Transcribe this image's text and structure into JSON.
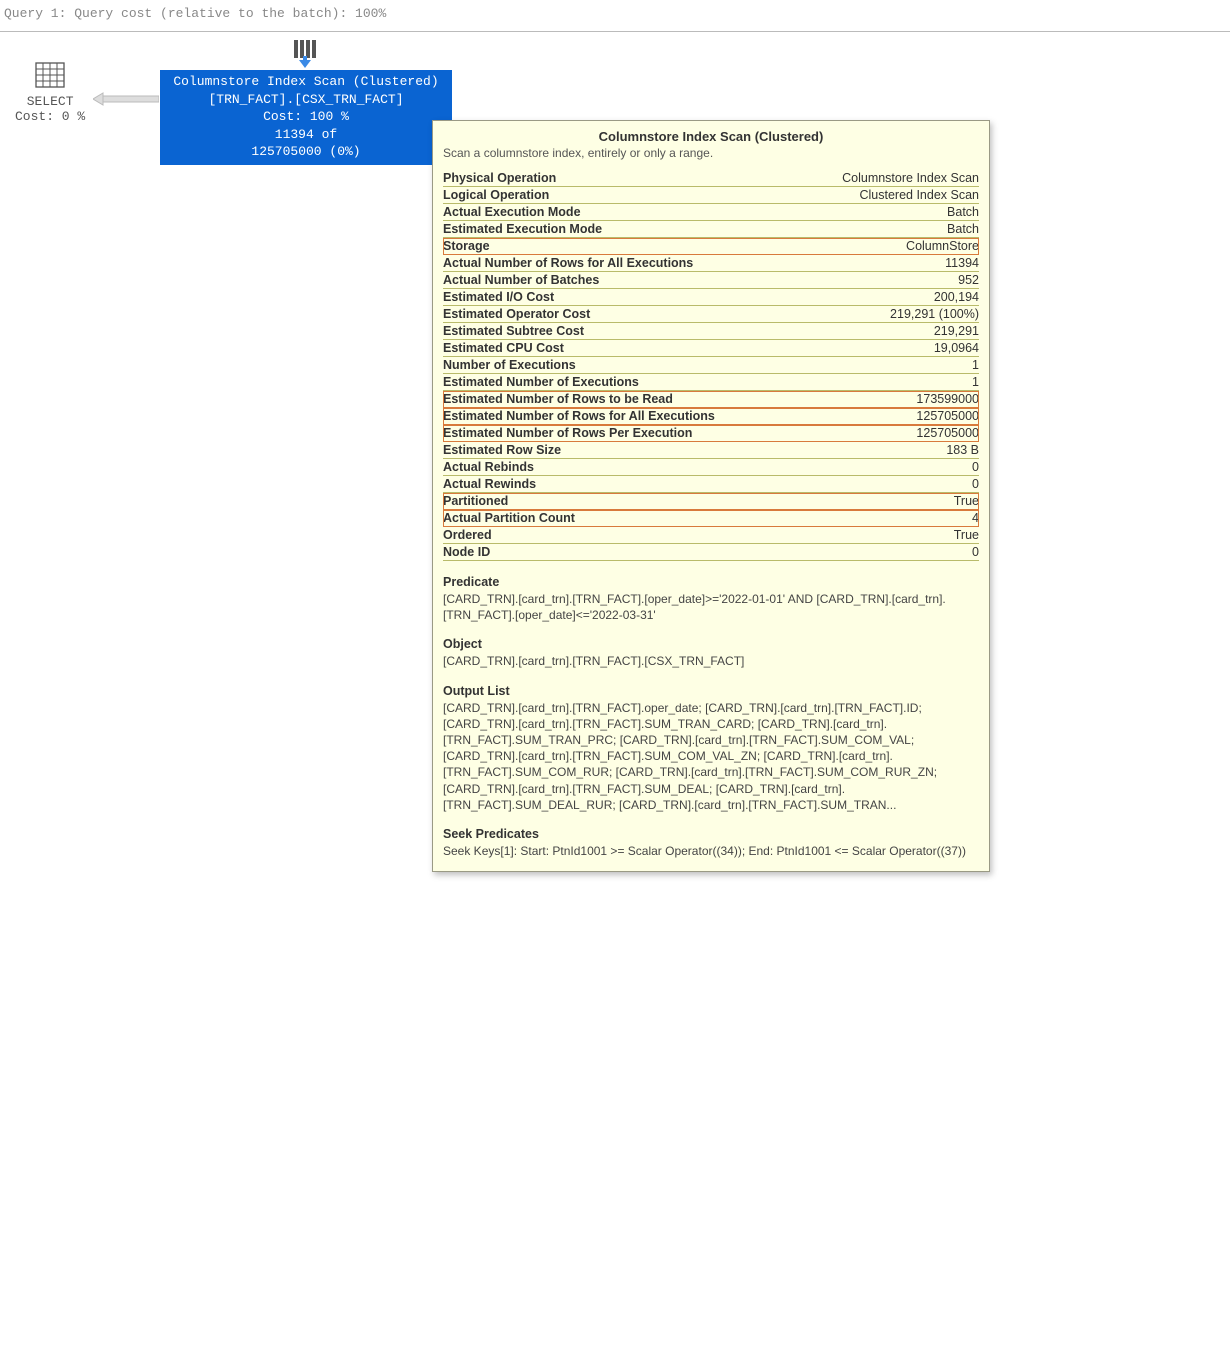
{
  "header": {
    "query_label": "Query 1: Query cost (relative to the batch): 100%"
  },
  "plan": {
    "select_node": {
      "title": "SELECT",
      "cost_line": "Cost: 0 %"
    },
    "scan_node": {
      "line1": "Columnstore Index Scan (Clustered)",
      "line2": "[TRN_FACT].[CSX_TRN_FACT]",
      "line3": "Cost: 100 %",
      "line4": "11394 of",
      "line5": "125705000 (0%)"
    }
  },
  "tooltip": {
    "title": "Columnstore Index Scan (Clustered)",
    "subtitle": "Scan a columnstore index, entirely or only a range.",
    "rows": [
      {
        "label": "Physical Operation",
        "value": "Columnstore Index Scan",
        "hl": false
      },
      {
        "label": "Logical Operation",
        "value": "Clustered Index Scan",
        "hl": false
      },
      {
        "label": "Actual Execution Mode",
        "value": "Batch",
        "hl": false
      },
      {
        "label": "Estimated Execution Mode",
        "value": "Batch",
        "hl": false
      },
      {
        "label": "Storage",
        "value": "ColumnStore",
        "hl": true
      },
      {
        "label": "Actual Number of Rows for All Executions",
        "value": "11394",
        "hl": false
      },
      {
        "label": "Actual Number of Batches",
        "value": "952",
        "hl": false
      },
      {
        "label": "Estimated I/O Cost",
        "value": "200,194",
        "hl": false
      },
      {
        "label": "Estimated Operator Cost",
        "value": "219,291 (100%)",
        "hl": false
      },
      {
        "label": "Estimated Subtree Cost",
        "value": "219,291",
        "hl": false
      },
      {
        "label": "Estimated CPU Cost",
        "value": "19,0964",
        "hl": false
      },
      {
        "label": "Number of Executions",
        "value": "1",
        "hl": false
      },
      {
        "label": "Estimated Number of Executions",
        "value": "1",
        "hl": false
      },
      {
        "label": "Estimated Number of Rows to be Read",
        "value": "173599000",
        "hl": true
      },
      {
        "label": "Estimated Number of Rows for All Executions",
        "value": "125705000",
        "hl": true
      },
      {
        "label": "Estimated Number of Rows Per Execution",
        "value": "125705000",
        "hl": true
      },
      {
        "label": "Estimated Row Size",
        "value": "183 B",
        "hl": false
      },
      {
        "label": "Actual Rebinds",
        "value": "0",
        "hl": false
      },
      {
        "label": "Actual Rewinds",
        "value": "0",
        "hl": false
      },
      {
        "label": "Partitioned",
        "value": "True",
        "hl": true
      },
      {
        "label": "Actual Partition Count",
        "value": "4",
        "hl": true
      },
      {
        "label": "Ordered",
        "value": "True",
        "hl": false
      },
      {
        "label": "Node ID",
        "value": "0",
        "hl": false
      }
    ],
    "sections": {
      "predicate": {
        "head": "Predicate",
        "body": "[CARD_TRN].[card_trn].[TRN_FACT].[oper_date]>='2022-01-01' AND [CARD_TRN].[card_trn].[TRN_FACT].[oper_date]<='2022-03-31'"
      },
      "object": {
        "head": "Object",
        "body": "[CARD_TRN].[card_trn].[TRN_FACT].[CSX_TRN_FACT]"
      },
      "output_list": {
        "head": "Output List",
        "body": "[CARD_TRN].[card_trn].[TRN_FACT].oper_date; [CARD_TRN].[card_trn].[TRN_FACT].ID; [CARD_TRN].[card_trn].[TRN_FACT].SUM_TRAN_CARD; [CARD_TRN].[card_trn].[TRN_FACT].SUM_TRAN_PRC; [CARD_TRN].[card_trn].[TRN_FACT].SUM_COM_VAL; [CARD_TRN].[card_trn].[TRN_FACT].SUM_COM_VAL_ZN; [CARD_TRN].[card_trn].[TRN_FACT].SUM_COM_RUR; [CARD_TRN].[card_trn].[TRN_FACT].SUM_COM_RUR_ZN; [CARD_TRN].[card_trn].[TRN_FACT].SUM_DEAL; [CARD_TRN].[card_trn].[TRN_FACT].SUM_DEAL_RUR; [CARD_TRN].[card_trn].[TRN_FACT].SUM_TRAN..."
      },
      "seek_predicates": {
        "head": "Seek Predicates",
        "body": "Seek Keys[1]: Start: PtnId1001 >= Scalar Operator((34)); End: PtnId1001 <= Scalar Operator((37))"
      }
    }
  }
}
